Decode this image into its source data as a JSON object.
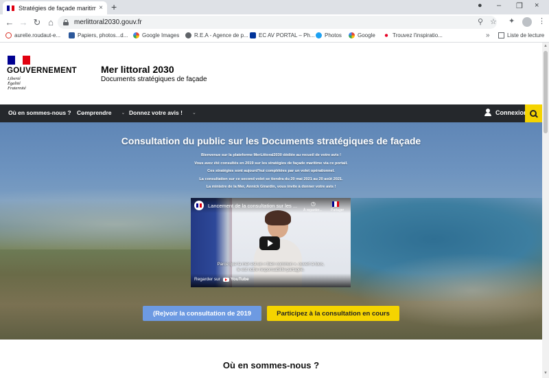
{
  "colors": {
    "flag_blue": "#000091",
    "flag_white": "#ffffff",
    "flag_red": "#e1000f",
    "nav_bg": "#25282c",
    "accent_yellow": "#f5d400",
    "button_blue": "#6d9ae2"
  },
  "browser": {
    "tab_title": "Stratégies de façade maritime |",
    "tab_close": "×",
    "new_tab": "+",
    "url": "merlittoral2030.gouv.fr",
    "nav": {
      "back": "←",
      "forward": "→",
      "reload": "↻",
      "home": "⌂"
    },
    "window_controls": {
      "collapse": "●",
      "minimize": "–",
      "maximize": "❐",
      "close": "×"
    },
    "toolbar_icons": {
      "zoom": "⚲",
      "star": "☆",
      "extensions": "✦",
      "menu": "⋮"
    },
    "bookmarks": [
      {
        "label": "aurelie.roudaut-e...",
        "icon": "opera-icon",
        "color": "#d93025"
      },
      {
        "label": "Papiers, photos...d...",
        "icon": "word-icon",
        "color": "#2b579a"
      },
      {
        "label": "Google Images",
        "icon": "google-icon",
        "color": "#4285f4"
      },
      {
        "label": "R.E.A - Agence de p...",
        "icon": "globe-icon",
        "color": "#5f6368"
      },
      {
        "label": "EC AV PORTAL – Ph...",
        "icon": "eu-flag-icon",
        "color": "#003399"
      },
      {
        "label": "Photos",
        "icon": "twitter-icon",
        "color": "#1da1f2"
      },
      {
        "label": "Google",
        "icon": "google-icon",
        "color": "#4285f4"
      },
      {
        "label": "Trouvez l'inspiratio...",
        "icon": "dots-icon",
        "color": "#e60023"
      }
    ],
    "bookmarks_more": "»",
    "reading_list": "Liste de lecture"
  },
  "header": {
    "gov_name": "GOUVERNEMENT",
    "motto": [
      "Liberté",
      "Égalité",
      "Fraternité"
    ],
    "site_title": "Mer littoral 2030",
    "site_subtitle": "Documents stratégiques de façade"
  },
  "navbar": {
    "items": [
      {
        "label": "Où en sommes-nous ?",
        "caret": "⌄"
      },
      {
        "label": "Comprendre",
        "caret": "⌄"
      },
      {
        "label": "Donnez votre avis !",
        "caret": "⌄"
      }
    ],
    "login": "Connexion"
  },
  "hero": {
    "title": "Consultation du public sur les Documents stratégiques de façade",
    "lines": [
      "Bienvenue sur la plateforme MerLittoral2030 dédiée au recueil de votre avis !",
      "Vous avez été consultés en 2019 sur les stratégies de façade maritime via ce portail.",
      "Ces stratégies sont aujourd'hui complétées par un volet opérationnel.",
      "La consultation sur ce second volet se tiendra du 20 mai 2021 au 20 août 2021.",
      "La ministre de la Mer, Annick Girardin, vous invite à donner votre avis !"
    ],
    "video": {
      "title": "Lancement de la consultation sur les ...",
      "watch_later": "À regarder...",
      "share": "Partager",
      "caption_line1": "Parce que la mer est un « bien commun », ouvert à tous,",
      "caption_line2": "le est notre responsabilité partagée.",
      "watch_on": "Regarder sur",
      "youtube": "YouTube"
    },
    "button_2019": "(Re)voir la consultation de 2019",
    "button_current": "Participez à la consultation en cours"
  },
  "section": {
    "title": "Où en sommes-nous ?"
  }
}
